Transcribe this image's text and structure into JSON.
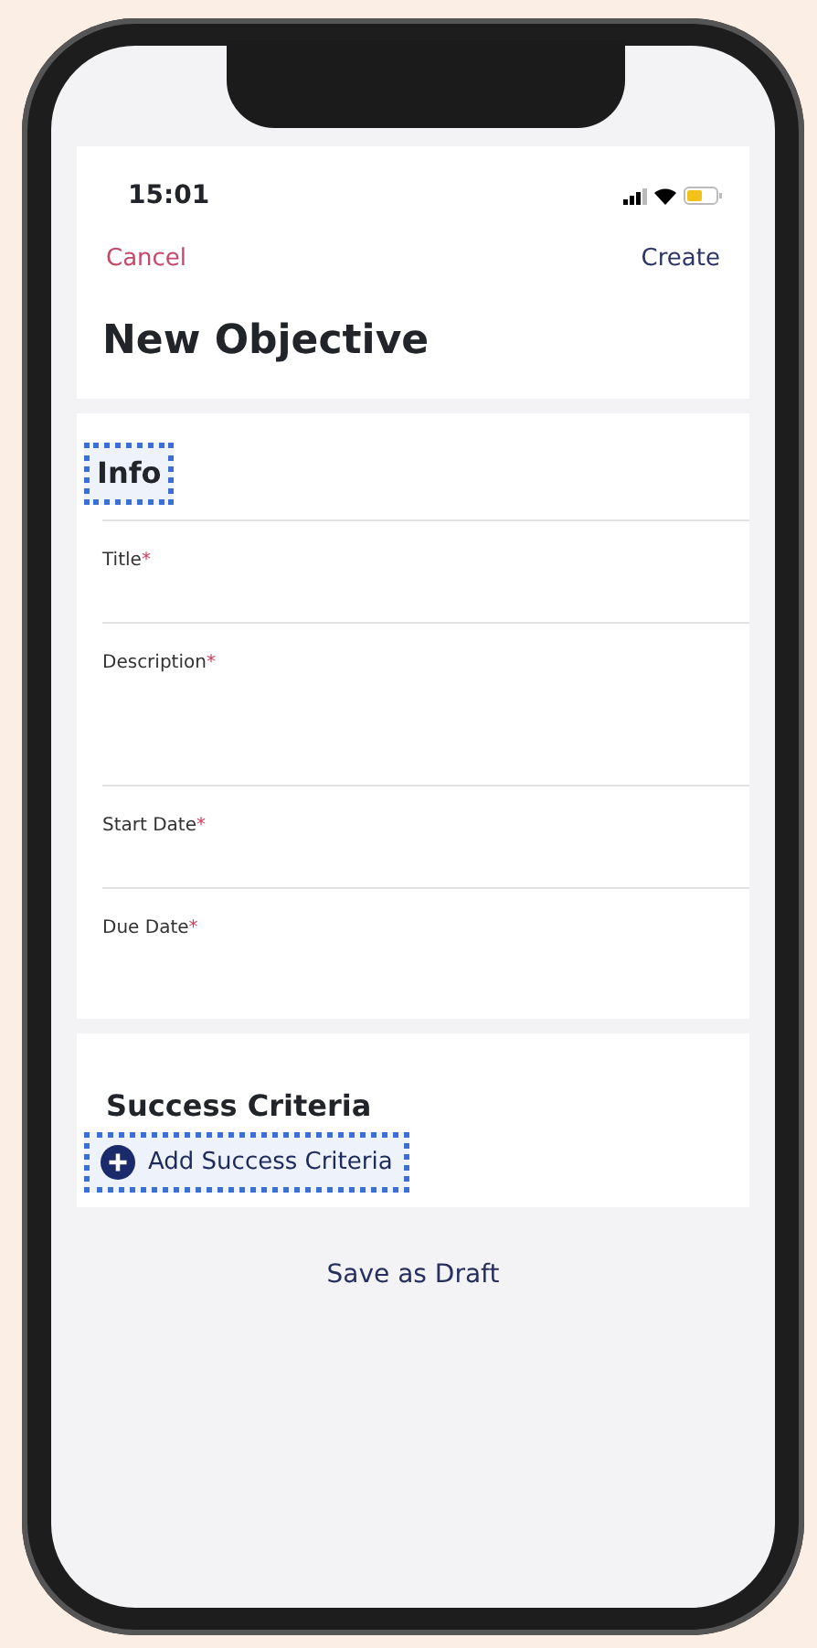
{
  "status_bar": {
    "time": "15:01"
  },
  "nav": {
    "cancel": "Cancel",
    "create": "Create"
  },
  "title": "New Objective",
  "info_section": {
    "heading": "Info",
    "focused": true,
    "fields": [
      {
        "label": "Title",
        "required_mark": "*",
        "kind": "line"
      },
      {
        "label": "Description",
        "required_mark": "*",
        "kind": "multiline"
      },
      {
        "label": "Start Date",
        "required_mark": "*",
        "kind": "line"
      },
      {
        "label": "Due Date",
        "required_mark": "*",
        "kind": "line"
      }
    ]
  },
  "success_section": {
    "heading": "Success Criteria",
    "add_button": {
      "label": "Add Success Criteria",
      "focused": true
    }
  },
  "save_draft": "Save as Draft"
}
